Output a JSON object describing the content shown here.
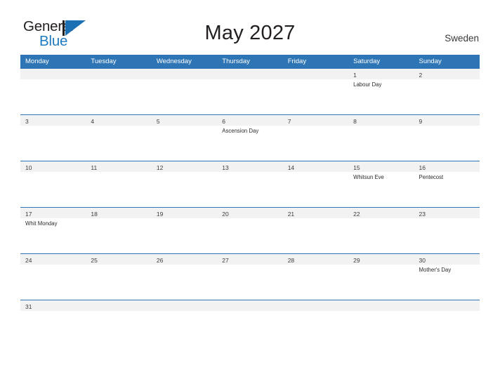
{
  "brand": {
    "name_top": "General",
    "name_bottom": "Blue",
    "accent_color": "#1b6fb3"
  },
  "header": {
    "title": "May 2027",
    "country": "Sweden"
  },
  "theme": {
    "header_blue": "#2e75b6",
    "row_divider": "#2e75b6",
    "daynum_strip": "#f2f2f2",
    "text": "#2b2b2b"
  },
  "calendar": {
    "weekday_headers": [
      "Monday",
      "Tuesday",
      "Wednesday",
      "Thursday",
      "Friday",
      "Saturday",
      "Sunday"
    ],
    "weeks": [
      [
        {
          "day": "",
          "events": []
        },
        {
          "day": "",
          "events": []
        },
        {
          "day": "",
          "events": []
        },
        {
          "day": "",
          "events": []
        },
        {
          "day": "",
          "events": []
        },
        {
          "day": "1",
          "events": [
            "Labour Day"
          ]
        },
        {
          "day": "2",
          "events": []
        }
      ],
      [
        {
          "day": "3",
          "events": []
        },
        {
          "day": "4",
          "events": []
        },
        {
          "day": "5",
          "events": []
        },
        {
          "day": "6",
          "events": [
            "Ascension Day"
          ]
        },
        {
          "day": "7",
          "events": []
        },
        {
          "day": "8",
          "events": []
        },
        {
          "day": "9",
          "events": []
        }
      ],
      [
        {
          "day": "10",
          "events": []
        },
        {
          "day": "11",
          "events": []
        },
        {
          "day": "12",
          "events": []
        },
        {
          "day": "13",
          "events": []
        },
        {
          "day": "14",
          "events": []
        },
        {
          "day": "15",
          "events": [
            "Whitsun Eve"
          ]
        },
        {
          "day": "16",
          "events": [
            "Pentecost"
          ]
        }
      ],
      [
        {
          "day": "17",
          "events": [
            "Whit Monday"
          ]
        },
        {
          "day": "18",
          "events": []
        },
        {
          "day": "19",
          "events": []
        },
        {
          "day": "20",
          "events": []
        },
        {
          "day": "21",
          "events": []
        },
        {
          "day": "22",
          "events": []
        },
        {
          "day": "23",
          "events": []
        }
      ],
      [
        {
          "day": "24",
          "events": []
        },
        {
          "day": "25",
          "events": []
        },
        {
          "day": "26",
          "events": []
        },
        {
          "day": "27",
          "events": []
        },
        {
          "day": "28",
          "events": []
        },
        {
          "day": "29",
          "events": []
        },
        {
          "day": "30",
          "events": [
            "Mother's Day"
          ]
        }
      ],
      [
        {
          "day": "31",
          "events": []
        },
        {
          "day": "",
          "events": []
        },
        {
          "day": "",
          "events": []
        },
        {
          "day": "",
          "events": []
        },
        {
          "day": "",
          "events": []
        },
        {
          "day": "",
          "events": []
        },
        {
          "day": "",
          "events": []
        }
      ]
    ]
  }
}
